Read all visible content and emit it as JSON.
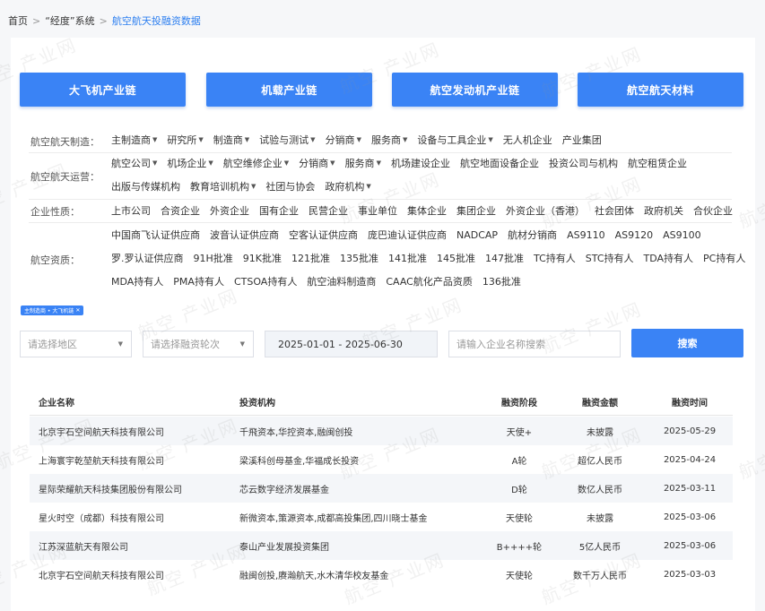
{
  "breadcrumb": {
    "home": "首页",
    "sep": ">",
    "system": "“经度”系统",
    "current": "航空航天投融资数据"
  },
  "categories": [
    "大飞机产业链",
    "机载产业链",
    "航空发动机产业链",
    "航空航天材料"
  ],
  "filters": {
    "manufacturing": {
      "label": "航空航天制造：",
      "options": [
        {
          "text": "主制造商",
          "dropdown": true
        },
        {
          "text": "研究所",
          "dropdown": true
        },
        {
          "text": "制造商",
          "dropdown": true
        },
        {
          "text": "试验与测试",
          "dropdown": true
        },
        {
          "text": "分销商",
          "dropdown": true
        },
        {
          "text": "服务商",
          "dropdown": true
        },
        {
          "text": "设备与工具企业",
          "dropdown": true
        },
        {
          "text": "无人机企业",
          "dropdown": false
        },
        {
          "text": "产业集团",
          "dropdown": false
        }
      ]
    },
    "operations": {
      "label": "航空航天运营：",
      "row1": [
        {
          "text": "航空公司",
          "dropdown": true
        },
        {
          "text": "机场企业",
          "dropdown": true
        },
        {
          "text": "航空维修企业",
          "dropdown": true
        },
        {
          "text": "分销商",
          "dropdown": true
        },
        {
          "text": "服务商",
          "dropdown": true
        },
        {
          "text": "机场建设企业",
          "dropdown": false
        },
        {
          "text": "航空地面设备企业",
          "dropdown": false
        },
        {
          "text": "投资公司与机构",
          "dropdown": false
        },
        {
          "text": "航空租赁企业",
          "dropdown": false
        }
      ],
      "row2": [
        {
          "text": "出版与传媒机构",
          "dropdown": false
        },
        {
          "text": "教育培训机构",
          "dropdown": true
        },
        {
          "text": "社团与协会",
          "dropdown": false
        },
        {
          "text": "政府机构",
          "dropdown": true
        }
      ]
    },
    "nature": {
      "label": "企业性质：",
      "options": [
        "上市公司",
        "合资企业",
        "外资企业",
        "国有企业",
        "民营企业",
        "事业单位",
        "集体企业",
        "集团企业",
        "外资企业（香港）",
        "社会团体",
        "政府机关",
        "合伙企业"
      ]
    },
    "qualification": {
      "label": "航空资质：",
      "row1": [
        "中国商飞认证供应商",
        "波音认证供应商",
        "空客认证供应商",
        "庞巴迪认证供应商",
        "NADCAP",
        "航材分销商",
        "AS9110",
        "AS9120",
        "AS9100"
      ],
      "row2": [
        "罗.罗认证供应商",
        "91H批准",
        "91K批准",
        "121批准",
        "135批准",
        "141批准",
        "145批准",
        "147批准",
        "TC持有人",
        "STC持有人",
        "TDA持有人",
        "PC持有人"
      ],
      "row3": [
        "MDA持有人",
        "PMA持有人",
        "CTSOA持有人",
        "航空油料制造商",
        "CAAC航化产品资质",
        "136批准"
      ]
    }
  },
  "active_tag": {
    "label": "主制造商 • 大飞机链",
    "close": "✕"
  },
  "search": {
    "region_placeholder": "请选择地区",
    "round_placeholder": "请选择融资轮次",
    "date_range": "2025-01-01 - 2025-06-30",
    "company_placeholder": "请输入企业名称搜索",
    "button": "搜索"
  },
  "table": {
    "headers": {
      "name": "企业名称",
      "investors": "投资机构",
      "stage": "融资阶段",
      "amount": "融资金额",
      "date": "融资时间"
    },
    "rows": [
      {
        "name": "北京宇石空间航天科技有限公司",
        "investors": "千飛资本,华控资本,融闽创投",
        "stage": "天使+",
        "amount": "未披露",
        "date": "2025-05-29"
      },
      {
        "name": "上海寰宇乾堃航天科技有限公司",
        "investors": "梁溪科创母基金,华福成长投资",
        "stage": "A轮",
        "amount": "超亿人民币",
        "date": "2025-04-24"
      },
      {
        "name": "星际荣耀航天科技集团股份有限公司",
        "investors": "芯云数字经济发展基金",
        "stage": "D轮",
        "amount": "数亿人民币",
        "date": "2025-03-11"
      },
      {
        "name": "星火时空（成都）科技有限公司",
        "investors": "新微资本,策源资本,成都高投集团,四川晓士基金",
        "stage": "天使轮",
        "amount": "未披露",
        "date": "2025-03-06"
      },
      {
        "name": "江苏深蓝航天有限公司",
        "investors": "泰山产业发展投资集团",
        "stage": "B++++轮",
        "amount": "5亿人民币",
        "date": "2025-03-06"
      },
      {
        "name": "北京宇石空间航天科技有限公司",
        "investors": "融闽创投,赓瀚航天,水木清华校友基金",
        "stage": "天使轮",
        "amount": "数千万人民币",
        "date": "2025-03-03"
      }
    ]
  },
  "watermark_text": "航空 产业网"
}
